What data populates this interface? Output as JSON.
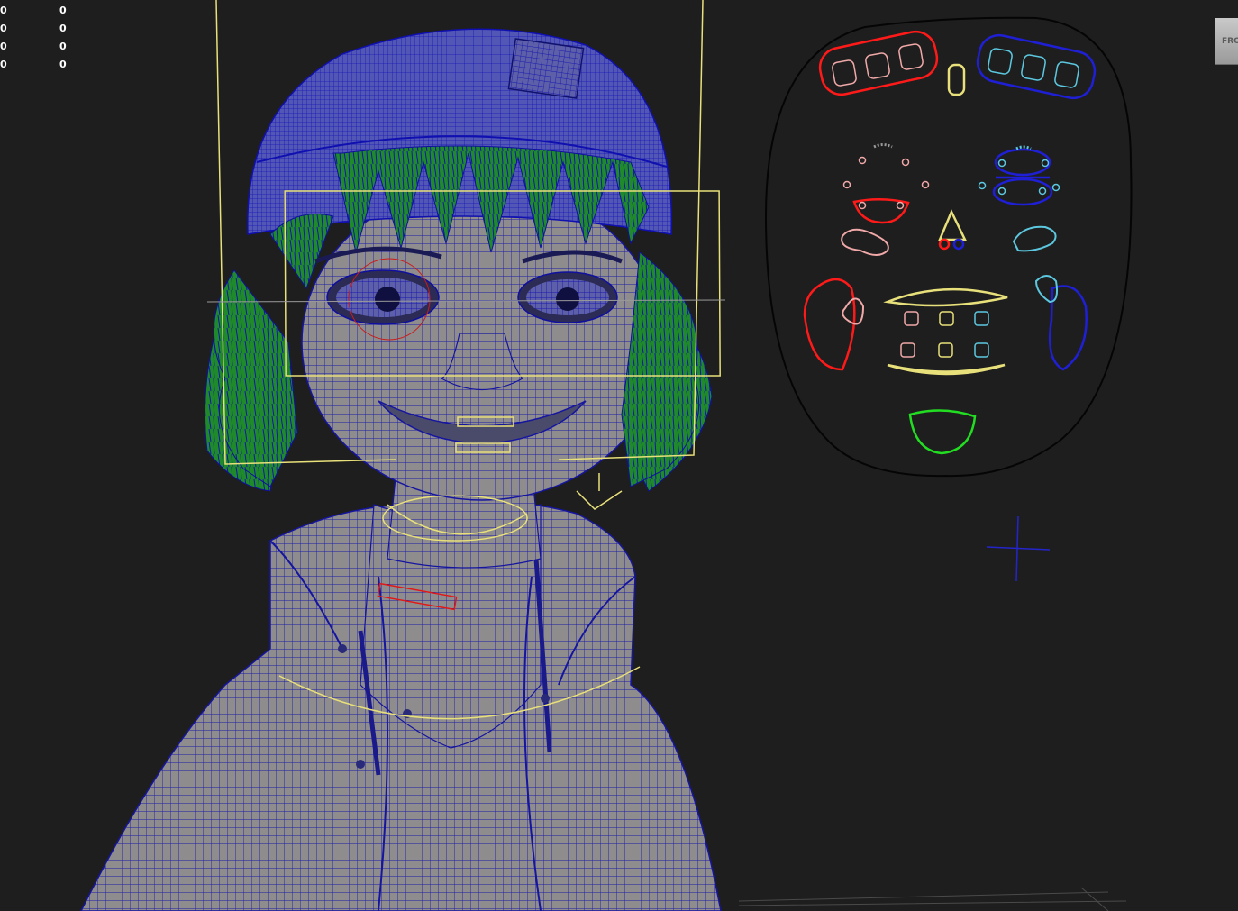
{
  "hud": {
    "rows": [
      {
        "label": "0",
        "value": "0"
      },
      {
        "label": "0",
        "value": "0"
      },
      {
        "label": "0",
        "value": "0"
      },
      {
        "label": "0",
        "value": "0"
      }
    ]
  },
  "view_cube": {
    "label": "FRO"
  },
  "colors": {
    "background": "#1e1e1e",
    "wire": "#1a1aa8",
    "hair": "#1f8a2a",
    "skin": "#8e8b8d",
    "control_yellow": "#e8e07a",
    "control_red": "#ff1a1a",
    "control_blue": "#1f1fd6",
    "control_cyan": "#5cc8e0",
    "control_pink": "#f0a8a8",
    "control_green": "#22dd22"
  }
}
